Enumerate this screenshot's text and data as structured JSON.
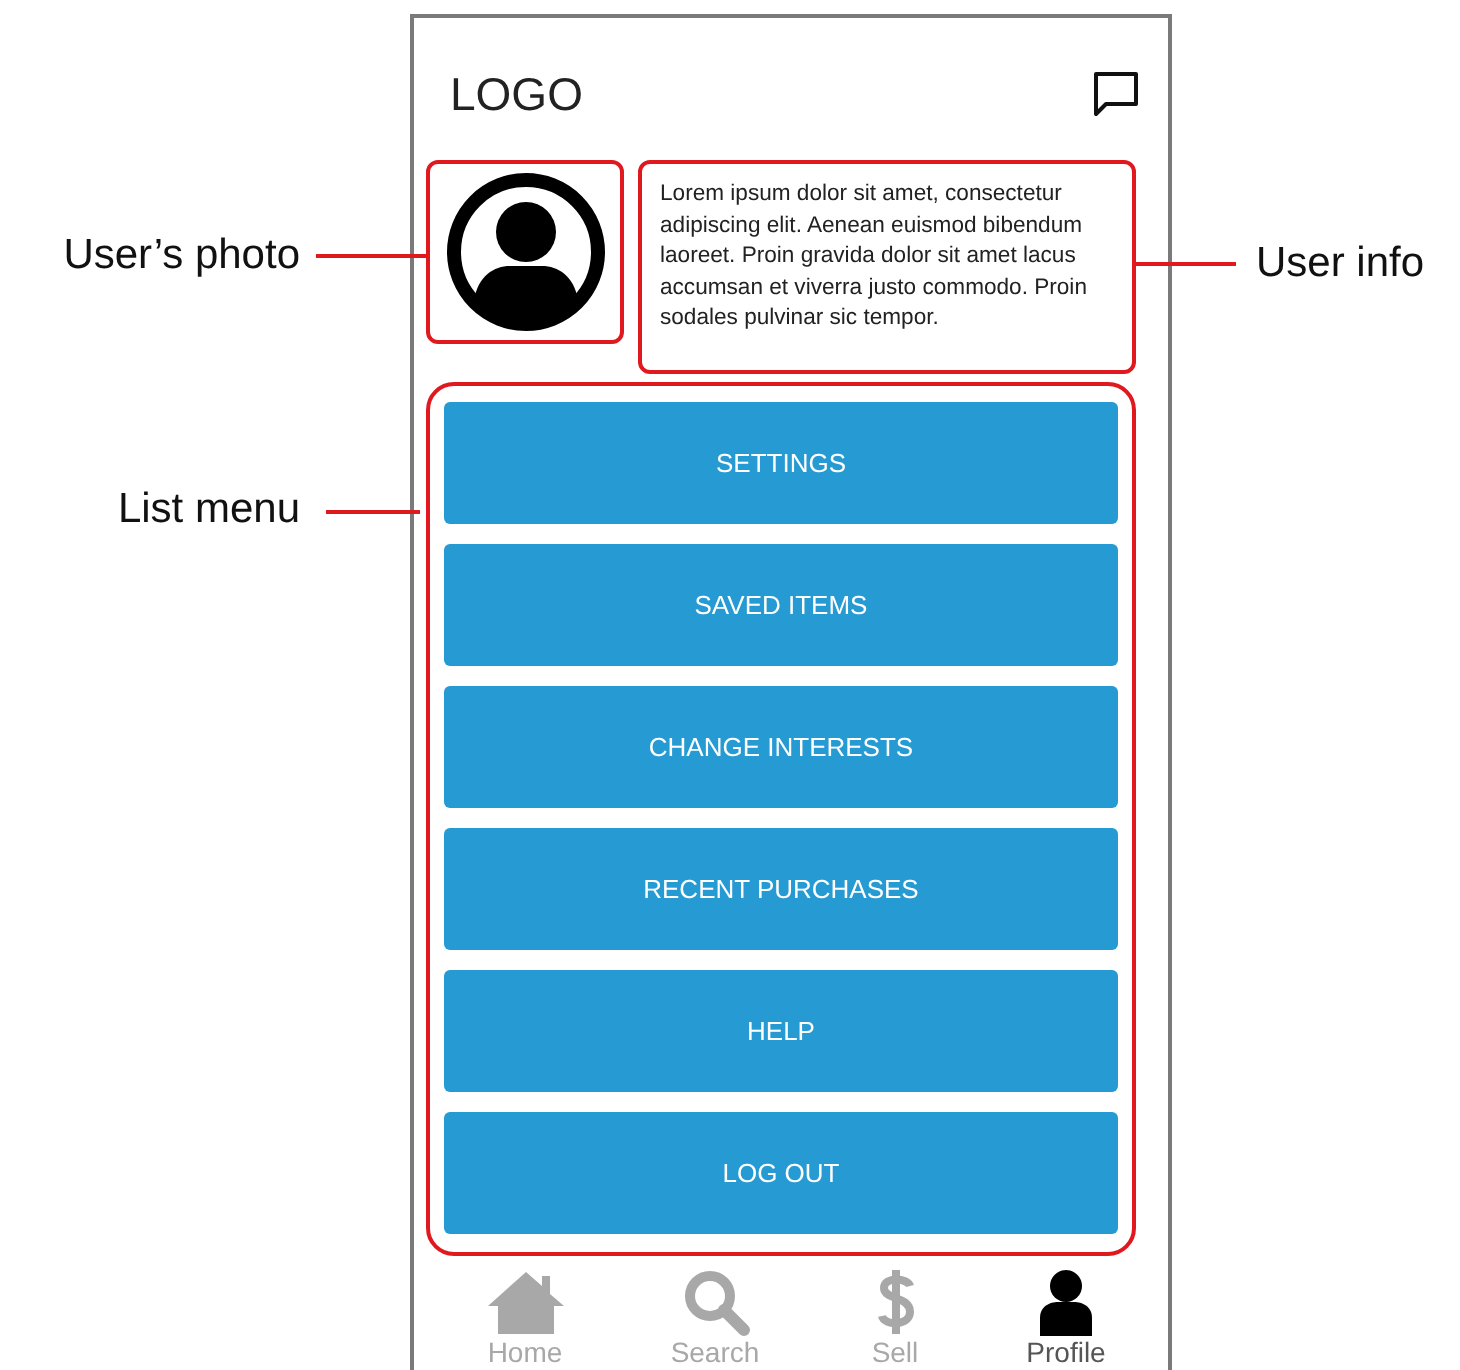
{
  "annotations": [
    {
      "label": "User’s photo"
    },
    {
      "label": "User info"
    },
    {
      "label": "List menu"
    }
  ],
  "header": {
    "logo": "LOGO"
  },
  "profile": {
    "info": "Lorem ipsum dolor sit amet, consectetur adipiscing elit. Aenean euismod bibendum laoreet. Proin gravida dolor sit amet lacus accumsan et viverra justo commodo. Proin sodales pulvinar sic tempor."
  },
  "menu": [
    {
      "label": "SETTINGS"
    },
    {
      "label": "SAVED ITEMS"
    },
    {
      "label": "CHANGE INTERESTS"
    },
    {
      "label": "RECENT PURCHASES"
    },
    {
      "label": "HELP"
    },
    {
      "label": "LOG OUT"
    }
  ],
  "nav": [
    {
      "kind": "home",
      "label": "Home",
      "selected": false
    },
    {
      "kind": "search",
      "label": "Search",
      "selected": false
    },
    {
      "kind": "sell",
      "label": "Sell",
      "selected": false
    },
    {
      "kind": "profile",
      "label": "Profile",
      "selected": true
    }
  ]
}
